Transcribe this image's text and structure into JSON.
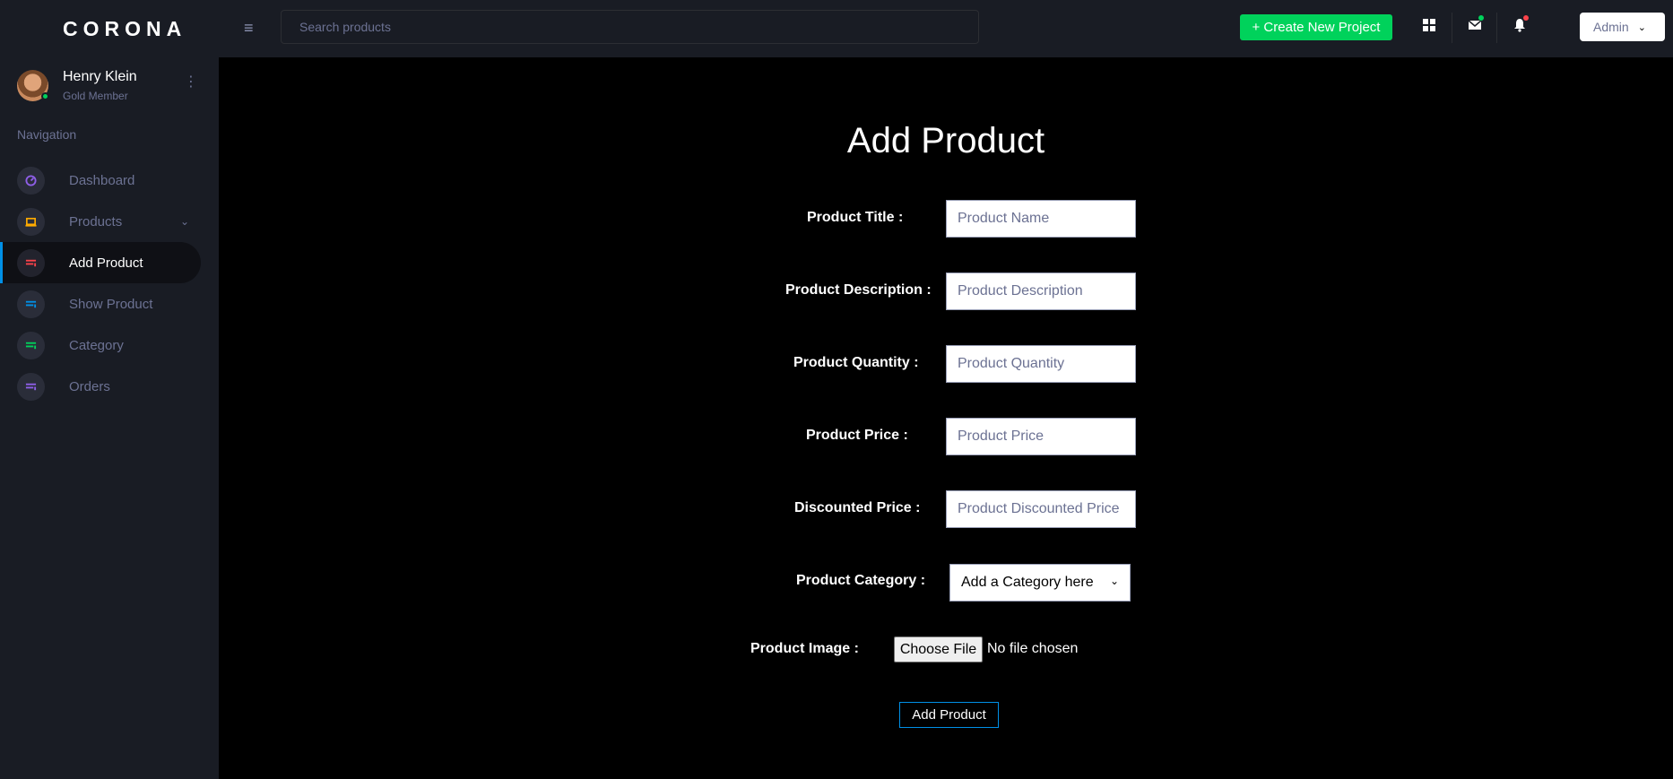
{
  "brand": "CORONA",
  "profile": {
    "name": "Henry Klein",
    "role": "Gold Member"
  },
  "nav_heading": "Navigation",
  "nav": [
    {
      "label": "Dashboard",
      "icon": "speedometer-icon",
      "color": "#8f5fe8"
    },
    {
      "label": "Products",
      "icon": "laptop-icon",
      "color": "#ffab00"
    },
    {
      "label": "Add Product",
      "icon": "list-icon",
      "color": "#fc424a"
    },
    {
      "label": "Show Product",
      "icon": "list-icon",
      "color": "#0090e7"
    },
    {
      "label": "Category",
      "icon": "list-icon",
      "color": "#00d25b"
    },
    {
      "label": "Orders",
      "icon": "list-icon",
      "color": "#8f5fe8"
    }
  ],
  "active_nav": "Add Product",
  "topbar": {
    "search_placeholder": "Search products",
    "create_label": "+ Create New Project",
    "admin_label": "Admin",
    "icons": [
      "grid-icon",
      "mail-icon",
      "bell-icon"
    ]
  },
  "form": {
    "title": "Add Product",
    "fields": [
      {
        "label": "Product Title :",
        "placeholder": "Product Name"
      },
      {
        "label": "Product Description :",
        "placeholder": "Product Description"
      },
      {
        "label": "Product Quantity :",
        "placeholder": "Product Quantity"
      },
      {
        "label": "Product Price :",
        "placeholder": "Product Price"
      },
      {
        "label": "Discounted Price :",
        "placeholder": "Product Discounted Price"
      }
    ],
    "category_label": "Product Category :",
    "category_value": "Add a Category here",
    "image_label": "Product Image :",
    "file_button": "Choose File",
    "file_status": "No file chosen",
    "submit_label": "Add Product"
  },
  "colors": {
    "sidebar_bg": "#191c24",
    "main_bg": "#000000",
    "accent": "#0090e7",
    "success": "#00d25b",
    "muted": "#6c7293"
  }
}
